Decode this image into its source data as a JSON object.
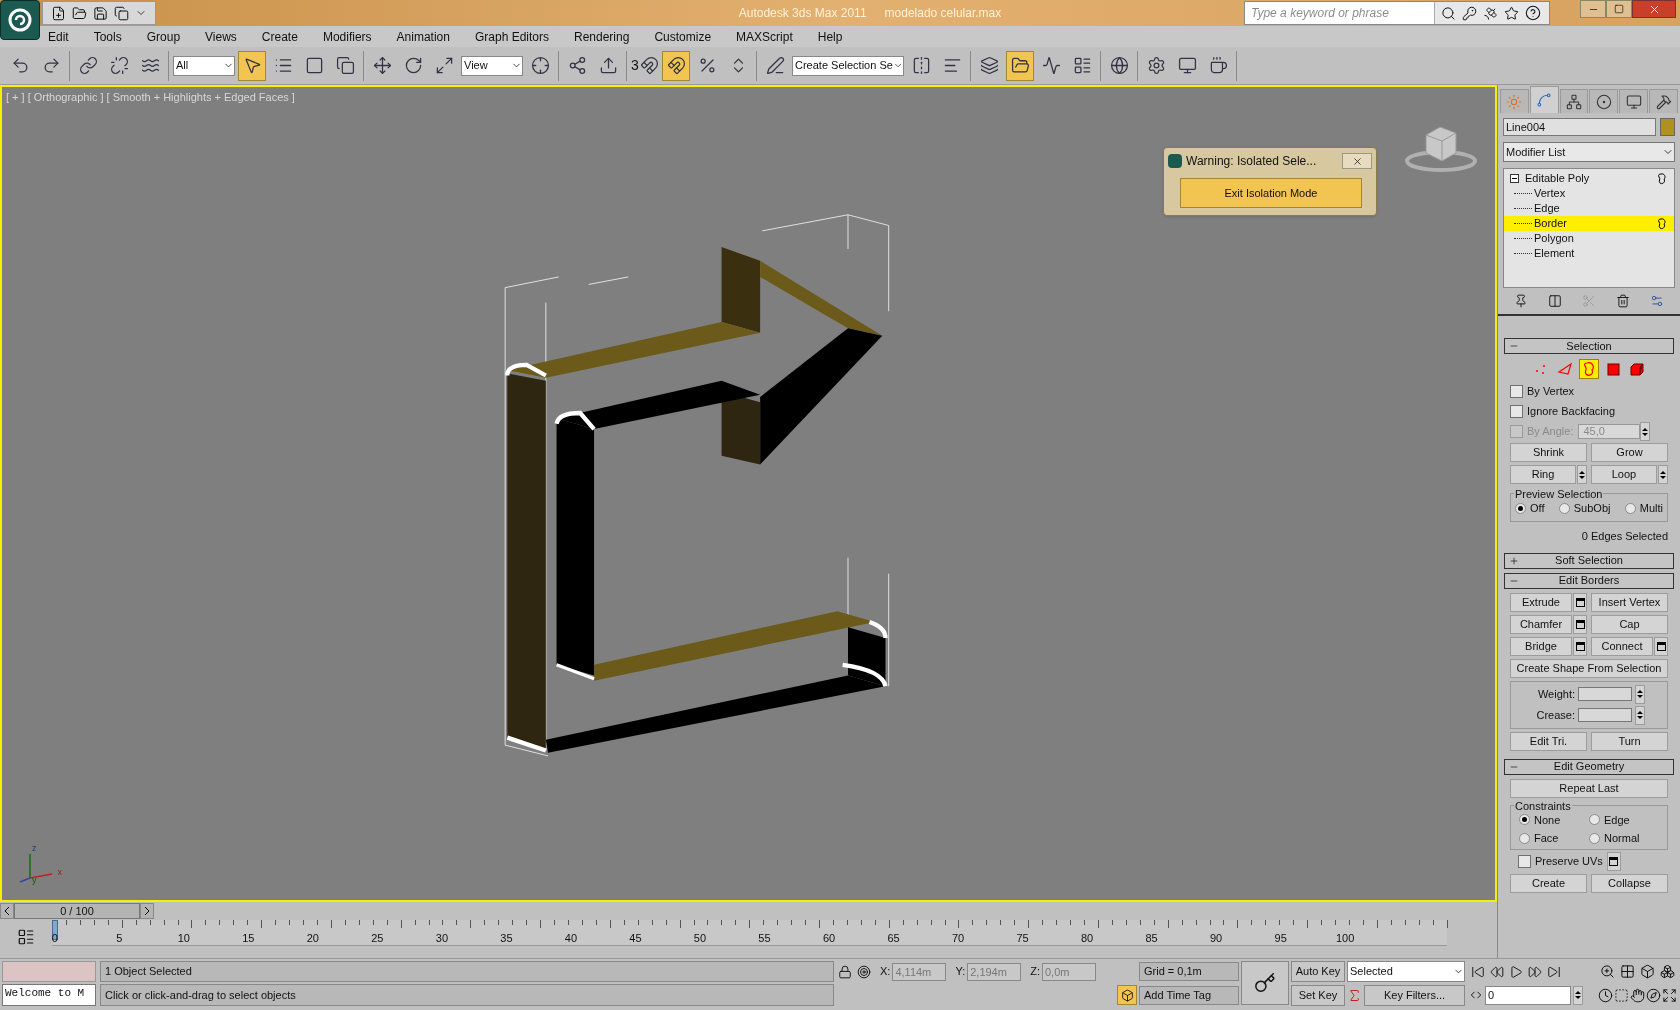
{
  "title_bar": {
    "app": "Autodesk 3ds Max  2011",
    "file": "modelado celular.max",
    "search": {
      "placeholder": "Type a keyword or phrase"
    }
  },
  "menu": [
    "Edit",
    "Tools",
    "Group",
    "Views",
    "Create",
    "Modifiers",
    "Animation",
    "Graph Editors",
    "Rendering",
    "Customize",
    "MAXScript",
    "Help"
  ],
  "toolbar": [
    [
      {
        "kind": "button",
        "selected": false
      },
      {
        "kind": "button",
        "selected": false
      }
    ],
    [
      {
        "kind": "button",
        "selected": false
      },
      {
        "kind": "button",
        "selected": false
      },
      {
        "kind": "button",
        "selected": false
      }
    ],
    [
      {
        "kind": "dropdown",
        "value": "All"
      },
      {
        "kind": "button",
        "selected": true
      },
      {
        "kind": "button",
        "selected": false
      },
      {
        "kind": "button",
        "selected": false
      },
      {
        "kind": "button",
        "selected": false
      }
    ],
    [
      {
        "kind": "button",
        "selected": false
      },
      {
        "kind": "button",
        "selected": false
      },
      {
        "kind": "button",
        "selected": false
      },
      {
        "kind": "dropdown",
        "value": "View"
      },
      {
        "kind": "button",
        "selected": false
      }
    ],
    [
      {
        "kind": "button",
        "selected": false
      },
      {
        "kind": "button",
        "selected": false
      }
    ],
    [
      {
        "kind": "button",
        "selected": false,
        "label": "3"
      },
      {
        "kind": "button",
        "selected": true
      },
      {
        "kind": "button",
        "selected": false
      },
      {
        "kind": "button",
        "selected": false
      }
    ],
    [
      {
        "kind": "button",
        "selected": false
      },
      {
        "kind": "dropdown",
        "value": "Create Selection Se"
      },
      {
        "kind": "button",
        "selected": false
      },
      {
        "kind": "button",
        "selected": false
      }
    ],
    [
      {
        "kind": "button",
        "selected": false
      },
      {
        "kind": "button",
        "selected": true
      },
      {
        "kind": "button",
        "selected": false
      },
      {
        "kind": "button",
        "selected": false
      }
    ],
    [
      {
        "kind": "button",
        "selected": false
      }
    ],
    [
      {
        "kind": "button",
        "selected": false
      },
      {
        "kind": "button",
        "selected": false
      },
      {
        "kind": "button",
        "selected": false
      }
    ]
  ],
  "viewport": {
    "label": "[ + ] [ Orthographic ] [ Smooth + Highlights + Edged Faces ]",
    "dialog": {
      "title": "Warning: Isolated Sele...",
      "button": "Exit Isolation Mode"
    },
    "axis_labels": [
      "z",
      "x",
      "y"
    ]
  },
  "timeline": {
    "slider": "0 / 100",
    "level": 0,
    "ruler_labels": [
      "0",
      "5",
      "10",
      "15",
      "20",
      "25",
      "30",
      "35",
      "40",
      "45",
      "50",
      "55",
      "60",
      "65",
      "70",
      "75",
      "80",
      "85",
      "90",
      "95",
      "100"
    ]
  },
  "command_panel": {
    "tabs": [
      {
        "selected": false
      },
      {
        "selected": true
      },
      {
        "selected": false
      },
      {
        "selected": false
      },
      {
        "selected": false
      },
      {
        "selected": false
      }
    ],
    "object_name": "Line004",
    "modifier_list": "Modifier List",
    "stack": {
      "label": "Editable Poly",
      "expanded": true,
      "children": [
        {
          "label": "Vertex",
          "selected": false
        },
        {
          "label": "Edge",
          "selected": false
        },
        {
          "label": "Border",
          "selected": true
        },
        {
          "label": "Polygon",
          "selected": false
        },
        {
          "label": "Element",
          "selected": false
        }
      ]
    },
    "rollouts": [
      {
        "kind": "selection",
        "title": "Selection",
        "expanded": true,
        "modes": [
          {
            "selected": false
          },
          {
            "selected": false
          },
          {
            "selected": true
          },
          {
            "selected": false
          },
          {
            "selected": false
          }
        ],
        "checkboxes": [
          {
            "label": "By Vertex",
            "checked": false,
            "disabled": false
          },
          {
            "label": "Ignore Backfacing",
            "checked": false,
            "disabled": false
          },
          {
            "label": "By Angle:",
            "checked": false,
            "disabled": true,
            "value": "45,0"
          }
        ],
        "buttons": [
          "Shrink",
          "Grow"
        ],
        "spin_buttons": [
          "Ring",
          "Loop"
        ],
        "preview": {
          "title": "Preview Selection",
          "options": [
            {
              "label": "Off",
              "selected": true
            },
            {
              "label": "SubObj",
              "selected": false
            },
            {
              "label": "Multi",
              "selected": false
            }
          ]
        },
        "status": "0 Edges Selected"
      },
      {
        "kind": "soft",
        "title": "Soft Selection",
        "expanded": false
      },
      {
        "kind": "borders",
        "title": "Edit Borders",
        "expanded": true,
        "buttons": [
          {
            "label": "Extrude",
            "settings": true
          },
          {
            "label": "Insert Vertex",
            "settings": false
          },
          {
            "label": "Chamfer",
            "settings": true
          },
          {
            "label": "Cap",
            "settings": false
          },
          {
            "label": "Bridge",
            "settings": true
          },
          {
            "label": "Connect",
            "settings": true
          }
        ],
        "wide_button": "Create Shape From Selection",
        "fields": [
          {
            "label": "Weight:"
          },
          {
            "label": "Crease:"
          }
        ],
        "tri_buttons": [
          "Edit Tri.",
          "Turn"
        ]
      },
      {
        "kind": "geometry",
        "title": "Edit Geometry",
        "expanded": true,
        "wide_button": "Repeat Last",
        "constraints": {
          "title": "Constraints",
          "options": [
            {
              "label": "None",
              "selected": true
            },
            {
              "label": "Edge",
              "selected": false
            },
            {
              "label": "Face",
              "selected": false
            },
            {
              "label": "Normal",
              "selected": false
            }
          ]
        },
        "preserve": {
          "label": "Preserve UVs",
          "checked": false
        },
        "buttons": [
          "Create",
          "Collapse"
        ]
      }
    ]
  },
  "status_bar": {
    "welcome": "Welcome to M",
    "selection_status": "1 Object Selected",
    "prompt": "Click or click-and-drag to select objects",
    "coords": [
      {
        "axis": "X:",
        "value": "4,114m"
      },
      {
        "axis": "Y:",
        "value": "2,194m"
      },
      {
        "axis": "Z:",
        "value": "0,0m"
      }
    ],
    "grid": "Grid = 0,1m",
    "time_tag": "Add Time Tag",
    "auto_key": "Auto Key",
    "set_key": "Set Key",
    "key_set": "Selected",
    "key_filters": "Key Filters...",
    "frame": "0"
  }
}
